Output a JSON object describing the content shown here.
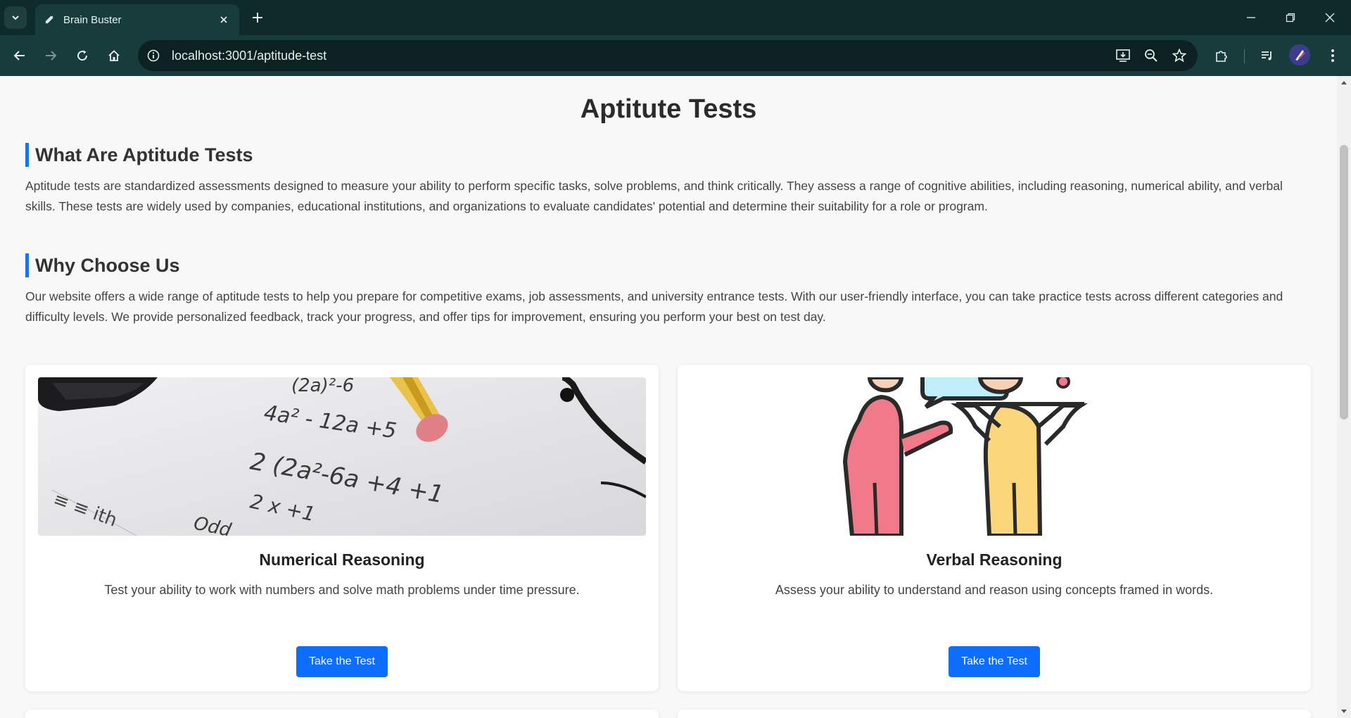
{
  "browser": {
    "tab_title": "Brain Buster",
    "url": "localhost:3001/aptitude-test"
  },
  "page": {
    "title": "Aptitute Tests",
    "sections": [
      {
        "heading": "What Are Aptitude Tests",
        "text": "Aptitude tests are standardized assessments designed to measure your ability to perform specific tasks, solve problems, and think critically. They assess a range of cognitive abilities, including reasoning, numerical ability, and verbal skills. These tests are widely used by companies, educational institutions, and organizations to evaluate candidates' potential and determine their suitability for a role or program."
      },
      {
        "heading": "Why Choose Us",
        "text": "Our website offers a wide range of aptitude tests to help you prepare for competitive exams, job assessments, and university entrance tests. With our user-friendly interface, you can take practice tests across different categories and difficulty levels. We provide personalized feedback, track your progress, and offer tips for improvement, ensuring you perform your best on test day."
      }
    ],
    "cards": [
      {
        "title": "Numerical Reasoning",
        "description": "Test your ability to work with numbers and solve math problems under time pressure.",
        "button": "Take the Test",
        "image_text": [
          "(2a)²-6",
          "4a² - 12a +5",
          "2 (2a²-6a +4 +1",
          "2 x +1",
          "Odd"
        ]
      },
      {
        "title": "Verbal Reasoning",
        "description": "Assess your ability to understand and reason using concepts framed in words.",
        "button": "Take the Test"
      }
    ]
  },
  "colors": {
    "accent": "#1a73e8",
    "button": "#0d6efd",
    "chrome_dark": "#0f2a2a",
    "chrome_toolbar": "#183c3c"
  }
}
